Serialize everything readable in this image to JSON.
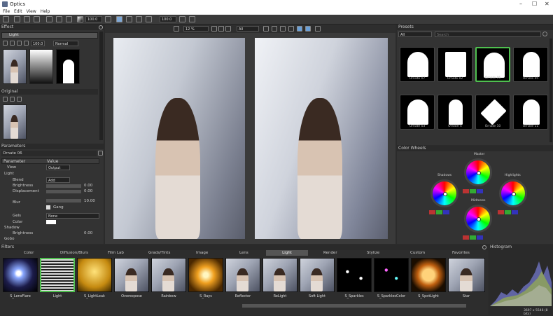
{
  "window": {
    "title": "Optics"
  },
  "menu": [
    "File",
    "Edit",
    "View",
    "Help"
  ],
  "toolbar": {
    "zoom_a": "100.0",
    "zoom_b": "100.0",
    "zoom_pct": "12 %",
    "mode": "All"
  },
  "effect_panel": {
    "header": "Effect",
    "layer_name": "Light",
    "opacity": "100.0",
    "blend": "Normal"
  },
  "original_panel": {
    "header": "Original"
  },
  "parameters": {
    "header": "Parameters",
    "preset_name": "Ornate 06",
    "col_param": "Parameter",
    "col_value": "Value",
    "rows": [
      {
        "label": "View",
        "value": "Output"
      },
      {
        "label": "Light",
        "value": ""
      },
      {
        "label": "Blend",
        "value": "Add"
      },
      {
        "label": "Brightness",
        "value": "0.00"
      },
      {
        "label": "Displacement",
        "value": "0.00"
      },
      {
        "label": "Blur",
        "value": "10.00"
      },
      {
        "label": "",
        "value": "Gang"
      },
      {
        "label": "Gels",
        "value": "None"
      },
      {
        "label": "Color",
        "value": ""
      },
      {
        "label": "Shadow",
        "value": ""
      },
      {
        "label": "Brightness",
        "value": "0.00"
      },
      {
        "label": "Gobo",
        "value": ""
      }
    ]
  },
  "presets": {
    "header": "Presets",
    "filter": "All",
    "search_placeholder": "Search",
    "items": [
      "Ornate 07",
      "Ornate 02",
      "Ornate 06",
      "Ornate 05",
      "Ornate 03",
      "Ornate 4",
      "Ornate 10",
      "Ornate 11"
    ]
  },
  "color_wheels": {
    "header": "Color Wheels",
    "wheels": [
      "Shadows",
      "Master",
      "Highlights",
      "Midtones"
    ]
  },
  "filters": {
    "header": "Filters",
    "categories": [
      "Color",
      "Diffusion/Blurs",
      "Film Lab",
      "Grads/Tints",
      "Image",
      "Lens",
      "Light",
      "Render",
      "Stylize",
      "Custom",
      "Favorites"
    ],
    "active_category": "Light",
    "items": [
      "S_LensFlare",
      "Light",
      "S_LightLeak",
      "Overexpose",
      "Rainbow",
      "S_Rays",
      "Reflector",
      "ReLight",
      "Soft Light",
      "S_Sparkles",
      "S_SparklesColor",
      "S_SpotLight",
      "Star"
    ]
  },
  "histogram": {
    "header": "Histogram",
    "status": "3697 x 5546 (8 bits)"
  }
}
